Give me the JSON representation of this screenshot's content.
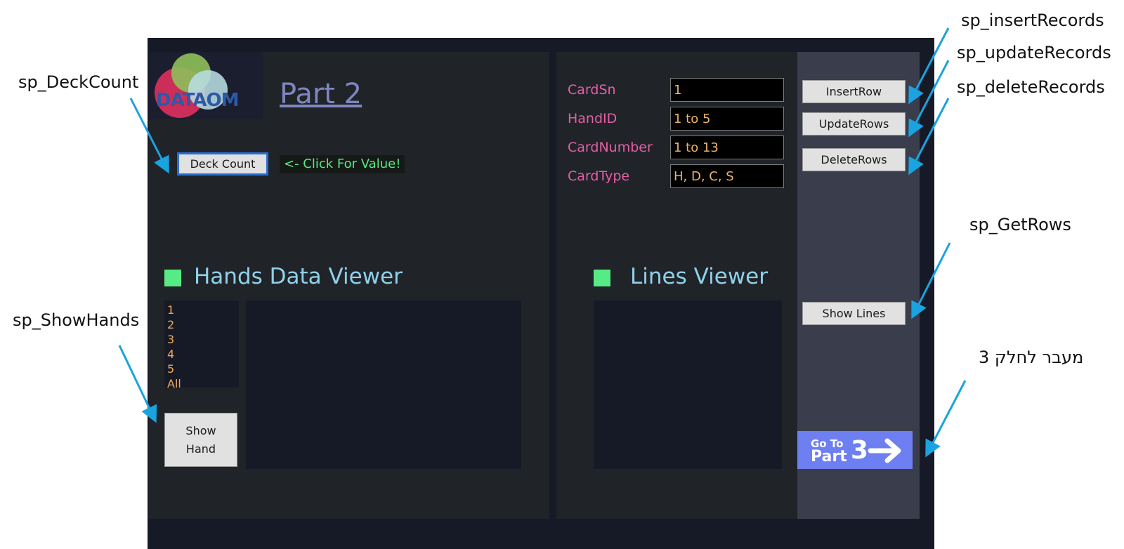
{
  "annotations": {
    "deck_count": "sp_DeckCount",
    "show_hands": "sp_ShowHands",
    "insert_records": "sp_insertRecords",
    "update_records": "sp_updateRecords",
    "delete_records": "sp_deleteRecords",
    "get_rows": "sp_GetRows",
    "go_part3": "מעבר לחלק 3"
  },
  "header": {
    "logo_text": "DATAOM",
    "title": "Part 2"
  },
  "deck": {
    "button_label": "Deck Count",
    "hint": "<- Click For Value!"
  },
  "form": {
    "fields": [
      {
        "label": "CardSn",
        "value": "1"
      },
      {
        "label": "HandID",
        "value": "1 to 5"
      },
      {
        "label": "CardNumber",
        "value": "1 to 13"
      },
      {
        "label": "CardType",
        "value": "H, D, C, S"
      }
    ]
  },
  "actions": {
    "insert_label": "InsertRow",
    "update_label": "UpdateRows",
    "delete_label": "DeleteRows",
    "show_lines_label": "Show Lines"
  },
  "hands_viewer": {
    "title": "Hands Data Viewer",
    "hand_options": [
      "1",
      "2",
      "3",
      "4",
      "5",
      "All"
    ],
    "show_button_label": "Show\nHand"
  },
  "lines_viewer": {
    "title": "Lines Viewer"
  },
  "nav": {
    "goto_line1": "Go To",
    "goto_line2": "Part",
    "goto_number": "3"
  },
  "colors": {
    "app_bg": "#161a26",
    "panel_bg": "#202428",
    "sidebar_bg": "#3a3d4b",
    "label_pink": "#e65da8",
    "value_orange": "#f0b366",
    "title_cyan": "#8fd1ea",
    "accent_green": "#56eb84",
    "annotation_arrow": "#1aa3e0",
    "goto_blue": "#6e7ff2"
  }
}
